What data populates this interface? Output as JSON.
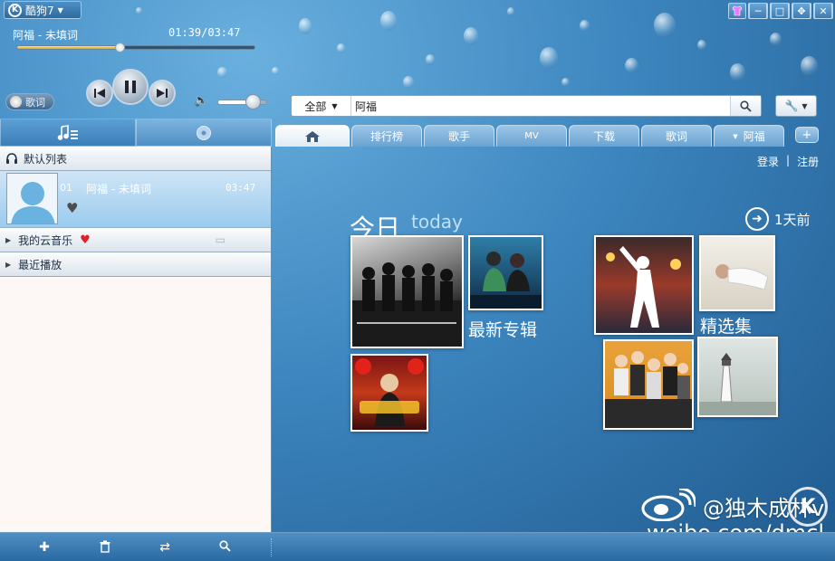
{
  "app": {
    "name": "酷狗7"
  },
  "player": {
    "song": "阿福 - 未填词",
    "time": "01:39/03:47",
    "progress_fraction": 0.436,
    "volume_fraction": 0.75,
    "lyrics_label": "歌词"
  },
  "search": {
    "scope": "全部",
    "query": "阿福"
  },
  "tabs": [
    {
      "label": ""
    },
    {
      "label": "排行榜"
    },
    {
      "label": "歌手"
    },
    {
      "label": "MV"
    },
    {
      "label": "下载"
    },
    {
      "label": "歌词"
    },
    {
      "label": "阿福"
    }
  ],
  "playlist": {
    "header": "默认列表",
    "current": {
      "index": "01",
      "name": "阿福 - 未填词",
      "duration": "03:47"
    },
    "groups": [
      {
        "label": "我的云音乐"
      },
      {
        "label": "最近播放"
      }
    ]
  },
  "account": {
    "login": "登录",
    "register": "注册"
  },
  "home": {
    "today_label": "今日",
    "today_sub": "today",
    "prev_day": "1天前",
    "new_albums_label": "最新专辑",
    "featured_label": "精选集"
  },
  "watermark": {
    "handle": "@独木成林v",
    "url": "weibo.com/dmcl"
  },
  "colors": {
    "accent": "#3d86bf",
    "progress": "#e3a717",
    "heart": "#e0202a"
  }
}
